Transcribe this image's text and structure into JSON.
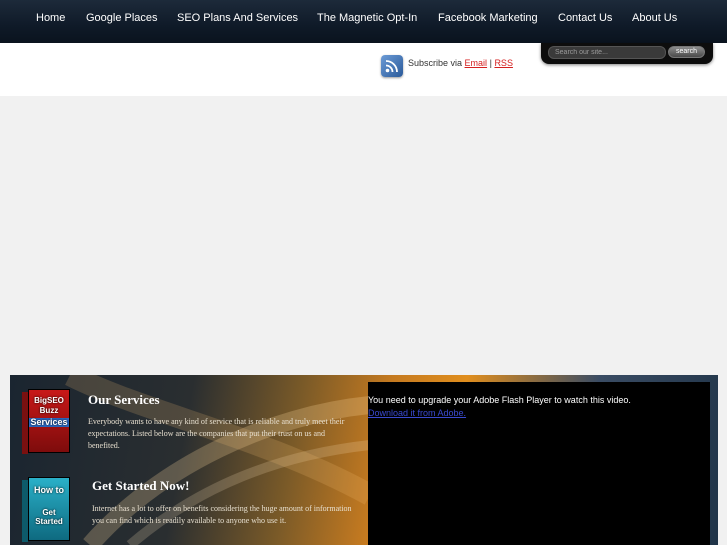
{
  "nav": {
    "items": [
      {
        "label": "Home"
      },
      {
        "label": "Google Places"
      },
      {
        "label": "SEO Plans And Services"
      },
      {
        "label": "The Magnetic Opt-In"
      },
      {
        "label": "Facebook Marketing"
      },
      {
        "label": "Contact Us"
      },
      {
        "label": "About Us"
      }
    ]
  },
  "header": {
    "subscribe_prefix": "Subscribe via",
    "email_link": "Email",
    "separator": "|",
    "rss_link": "RSS",
    "rss_icon": "rss-icon"
  },
  "search": {
    "placeholder": "Search our site...",
    "button_label": "search"
  },
  "services": {
    "title": "Our Services",
    "body": "Everybody wants to have any kind of service that is reliable and truly meet their expectations. Listed below are the companies that put their trust on us and benefited.",
    "box_label_1": "BigSEO",
    "box_label_2": "Buzz",
    "box_label_3": "Services"
  },
  "get_started": {
    "title": "Get Started Now!",
    "body": "Internet has a lot to offer on benefits considering the huge amount of information you can find which is readily available to anyone who use it.",
    "box_label_1": "How to",
    "box_label_2": "Get Started"
  },
  "video": {
    "message": "You need to upgrade your Adobe Flash Player to watch this video.",
    "link": "Download it from Adobe."
  },
  "colors": {
    "nav_bg": "#0f1a28",
    "link_red": "#d52020",
    "panel_orange": "#e08e1e"
  }
}
